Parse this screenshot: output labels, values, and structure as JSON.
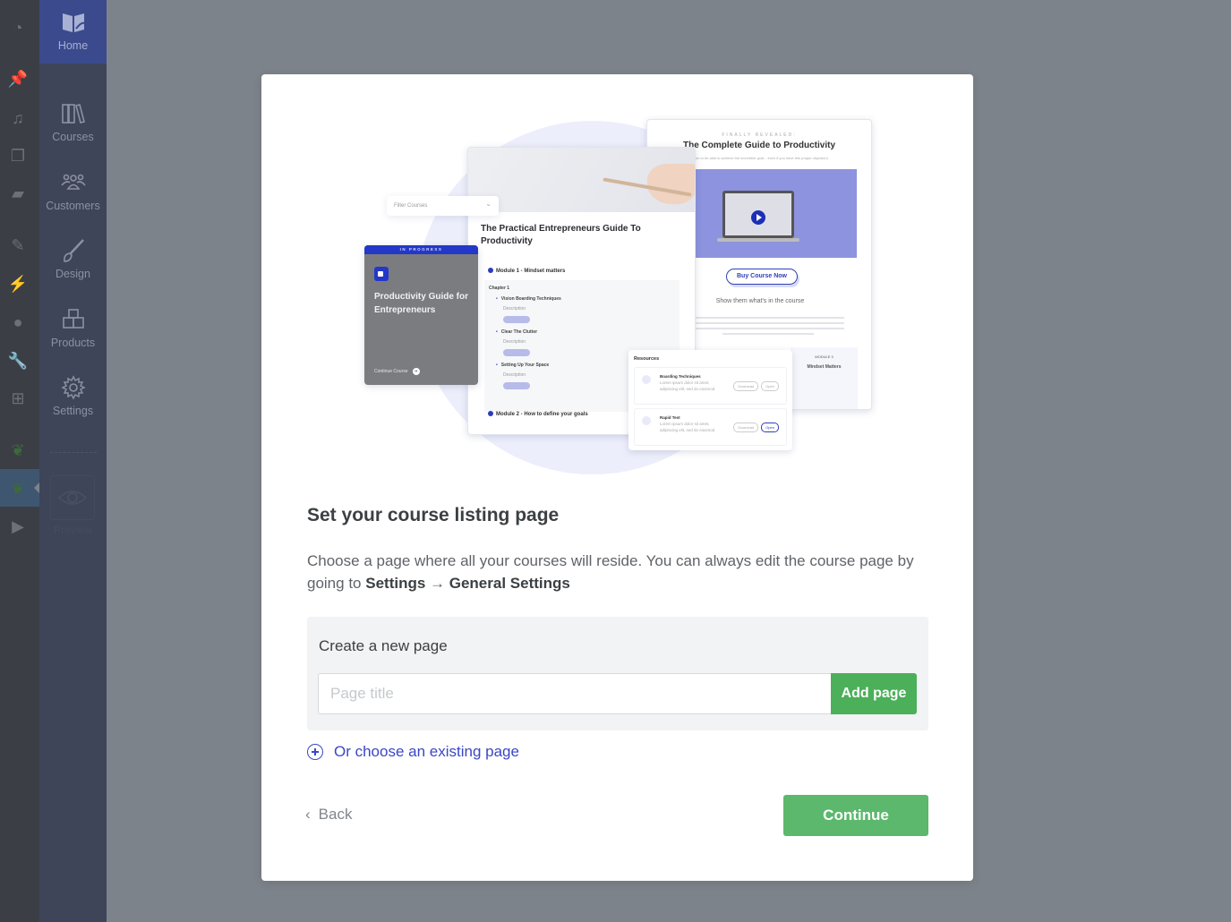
{
  "wp_admin_bar": {
    "icons": [
      "dashboard-icon",
      "pin-icon",
      "media-icon",
      "pages-icon",
      "comments-icon",
      "appearance-icon",
      "plugins-icon",
      "users-icon",
      "tools-icon",
      "settings-sliders-icon",
      "leaf-icon",
      "leaf-active-icon",
      "play-icon"
    ]
  },
  "sidebar": {
    "items": [
      {
        "label": "Home",
        "icon": "open-book-leaf-icon",
        "active": true
      },
      {
        "label": "Courses",
        "icon": "books-icon"
      },
      {
        "label": "Customers",
        "icon": "people-group-icon"
      },
      {
        "label": "Design",
        "icon": "paintbrush-icon"
      },
      {
        "label": "Products",
        "icon": "boxes-icon"
      },
      {
        "label": "Settings",
        "icon": "gear-icon"
      }
    ],
    "preview_label": "Preview"
  },
  "illustration": {
    "filter_label": "Filter Courses",
    "progress_card": {
      "badge": "IN PROGRESS",
      "title": "Productivity Guide for Entrepreneurs",
      "cta": "Continue Course"
    },
    "course_page": {
      "title": "The Practical Entrepreneurs Guide To Productivity",
      "module1": "Module 1 - Mindset matters",
      "chapter": "Chapter 1",
      "lessons": [
        {
          "name": "Vision Boarding Techniques",
          "description": "Description"
        },
        {
          "name": "Clear The Clutter",
          "description": "Description"
        },
        {
          "name": "Setting Up Your Space",
          "description": "Description"
        }
      ],
      "module2": "Module 2 - How to define your goals"
    },
    "sales_page": {
      "kicker": "FINALLY REVEALED:",
      "title": "The Complete Guide to Productivity",
      "subtitle": "Learn to be able to achieve the incredible goal... even if you have this (major objection)",
      "buy_button": "Buy Course Now",
      "section_title": "Show them what's in the course",
      "module_kicker": "MODULE 3",
      "module_title": "Mindset Matters"
    },
    "resources": {
      "title": "Resources",
      "items": [
        {
          "title": "Boarding Techniques",
          "body": "Lorem ipsum dolor sit amet, adipiscing elit, sed do eiusmod",
          "download": "Download",
          "open": "Open"
        },
        {
          "title": "Rapid Test",
          "body": "Lorem ipsum dolor sit amet, adipiscing elit, sed do eiusmod",
          "download": "Download",
          "open": "Open"
        }
      ]
    }
  },
  "modal": {
    "heading": "Set your course listing page",
    "description_prefix": "Choose a page where all your courses will reside. You can always edit the course page by going to ",
    "description_settings": "Settings",
    "description_arrow": " → ",
    "description_general": "General Settings",
    "create_label": "Create a new page",
    "page_title_placeholder": "Page title",
    "page_title_value": "",
    "add_page_label": "Add page",
    "existing_label": "Or choose an existing page",
    "back_label": "Back",
    "continue_label": "Continue"
  },
  "colors": {
    "accent_green": "#5cb86c",
    "add_green": "#4caf5a",
    "link_blue": "#3a47c6",
    "sidebar_bg": "#3e4559",
    "sidebar_active": "#3a4a8c"
  }
}
